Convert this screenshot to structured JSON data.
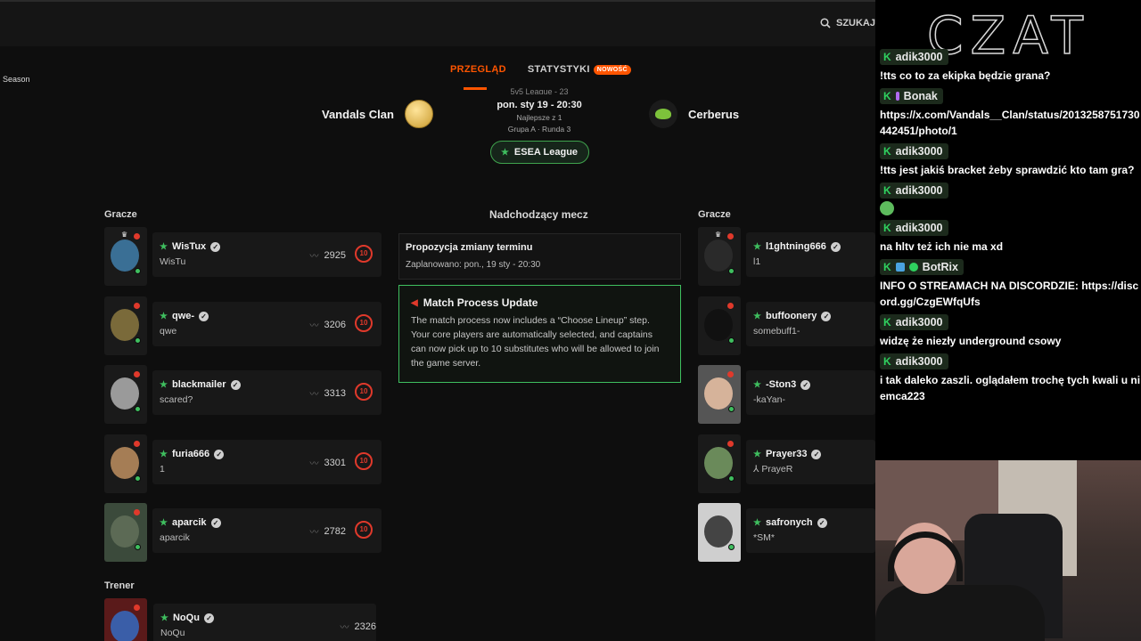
{
  "site": {
    "search_label": "SZUKAJ",
    "season_label": "Season",
    "tabs": {
      "overview": "PRZEGLĄD",
      "stats": "STATYSTYKI",
      "stats_badge": "NOWOŚĆ"
    },
    "match": {
      "team_left": "Vandals Clan",
      "team_right": "Cerberus",
      "league_cut": "5v5 League - 23",
      "date": "pon. sty 19 - 20:30",
      "best_of": "Najlepsze z 1",
      "group_round": "Grupa A · Runda 3",
      "league_button": "ESEA League"
    },
    "left_header": "Gracze",
    "right_header": "Gracze",
    "coach_header": "Trener",
    "center_header": "Nadchodzący mecz",
    "reschedule": {
      "title": "Propozycja zmiany terminu",
      "subtitle": "Zaplanowano: pon., 19 sty - 20:30"
    },
    "update": {
      "title": "Match Process Update",
      "body": "The match process now includes a “Choose Lineup” step. Your core players are automatically selected, and captains can now pick up to 10 substitutes who will be allowed to join the game server."
    },
    "left_players": [
      {
        "name": "WisTux",
        "nick": "WisTu",
        "elo": "2925",
        "level": "10"
      },
      {
        "name": "qwe-",
        "nick": "qwe",
        "elo": "3206",
        "level": "10"
      },
      {
        "name": "blackmailer",
        "nick": "scared?",
        "elo": "3313",
        "level": "10"
      },
      {
        "name": "furia666",
        "nick": "1",
        "elo": "3301",
        "level": "10"
      },
      {
        "name": "aparcik",
        "nick": "aparcik",
        "elo": "2782",
        "level": "10"
      }
    ],
    "coach": {
      "name": "NoQu",
      "nick": "NoQu",
      "elo": "2326"
    },
    "right_players": [
      {
        "name": "l1ghtning666",
        "nick": "l1"
      },
      {
        "name": "buffoonery",
        "nick": "somebuff1-"
      },
      {
        "name": "-Ston3",
        "nick": "-kaYan-"
      },
      {
        "name": "Prayer33",
        "nick": "⅄ PrayeR"
      },
      {
        "name": "safronych",
        "nick": "*SM*"
      }
    ]
  },
  "stream": {
    "title": "CZAT",
    "messages": [
      {
        "user": "adik3000",
        "text": "!tts co to za ekipka będzie grana?"
      },
      {
        "user": "Bonak",
        "text": "https://x.com/Vandals__Clan/status/2013258751730442451/photo/1"
      },
      {
        "user": "adik3000",
        "text": "!tts jest jakiś bracket żeby sprawdzić kto tam gra?"
      },
      {
        "user": "adik3000",
        "text": ""
      },
      {
        "user": "adik3000",
        "text": "na hltv też ich nie ma xd"
      },
      {
        "user": "BotRix",
        "text": "INFO O STREAMACH NA DISCORDZIE: https://discord.gg/CzgEWfqUfs"
      },
      {
        "user": "adik3000",
        "text": "widzę że niezły underground csowy"
      },
      {
        "user": "adik3000",
        "text": "i tak daleko zaszli. oglądałem trochę tych kwali u niemca223"
      }
    ],
    "badge_letter": "K"
  },
  "colors": {
    "accent": "#ff5500",
    "green": "#3fbf5f",
    "level_red": "#e0392b"
  }
}
